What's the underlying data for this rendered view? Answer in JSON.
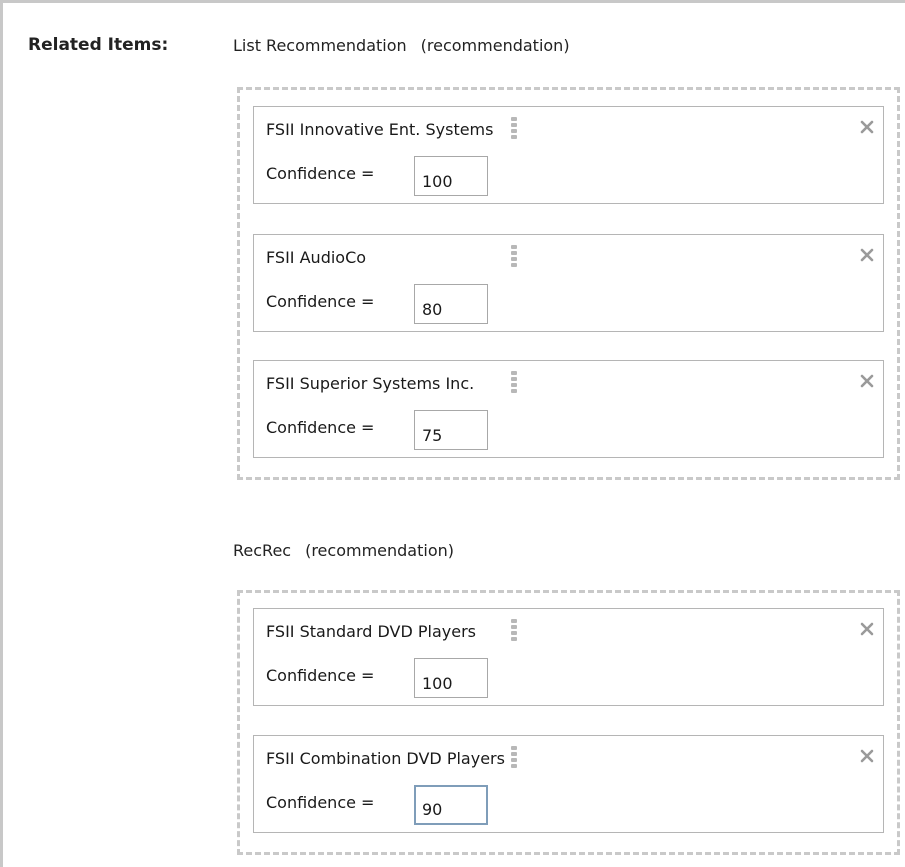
{
  "related_items_label": "Related Items:",
  "groups": [
    {
      "name": "List Recommendation",
      "type": "(recommendation)",
      "items": [
        {
          "name": "FSII Innovative Ent. Systems",
          "confidence_label": "Confidence =",
          "confidence": "100"
        },
        {
          "name": "FSII AudioCo",
          "confidence_label": "Confidence =",
          "confidence": "80"
        },
        {
          "name": "FSII Superior Systems Inc.",
          "confidence_label": "Confidence =",
          "confidence": "75"
        }
      ]
    },
    {
      "name": "RecRec",
      "type": "(recommendation)",
      "items": [
        {
          "name": "FSII Standard DVD Players",
          "confidence_label": "Confidence =",
          "confidence": "100"
        },
        {
          "name": "FSII Combination DVD Players",
          "confidence_label": "Confidence =",
          "confidence": "90"
        }
      ]
    }
  ],
  "icons": {
    "remove": "close-icon",
    "drag": "drag-handle-icon"
  },
  "colors": {
    "dashed_border": "#c9c9c9",
    "item_border": "#b5b5b5",
    "focus_border": "#7f9db9"
  }
}
